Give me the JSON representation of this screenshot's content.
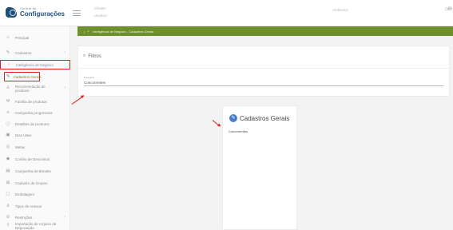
{
  "header": {
    "logo_small": "Central de",
    "logo_main": "Configurações",
    "client_label": "Cliente:",
    "user_label": "Usuário:",
    "environment_label": "Ambiente:",
    "top_icons": "⌂⊖"
  },
  "sidebar": {
    "items": [
      {
        "label": "Principal",
        "icon": "home-icon",
        "glyph": "⌂"
      },
      {
        "label": "Cadastros",
        "icon": "edit-icon",
        "glyph": "✎",
        "chevron": "›"
      },
      {
        "label": "Inteligência de Negócio",
        "icon": "bulb-icon",
        "glyph": "♀",
        "chevron": "›"
      },
      {
        "label": "Cadastros Gerais",
        "icon": "edit-icon",
        "glyph": "✎"
      },
      {
        "label": "Recomendação de produtos",
        "icon": "bag-icon",
        "glyph": "♙",
        "chevron": "›"
      },
      {
        "label": "Família de produtos",
        "icon": "family-icon",
        "glyph": "Ψ"
      },
      {
        "label": "Campanha progressiva",
        "icon": "steps-icon",
        "glyph": "≡"
      },
      {
        "label": "Detalhes de produtos",
        "icon": "info-icon",
        "glyph": "ⓘ"
      },
      {
        "label": "Dias Úteis",
        "icon": "calendar-icon",
        "glyph": "▣"
      },
      {
        "label": "Metas",
        "icon": "target-icon",
        "glyph": "◎"
      },
      {
        "label": "Combo de Descontos",
        "icon": "tags-icon",
        "glyph": "◆"
      },
      {
        "label": "Campanha de Brindes",
        "icon": "gift-icon",
        "glyph": "▤"
      },
      {
        "label": "Cadastro de Grupos",
        "icon": "group-icon",
        "glyph": "⊞"
      },
      {
        "label": "Embalagem",
        "icon": "package-icon",
        "glyph": "▢"
      },
      {
        "label": "Tipos de Anexos",
        "icon": "clip-icon",
        "glyph": "∂"
      },
      {
        "label": "Restrições",
        "icon": "restrict-icon",
        "glyph": "⊘",
        "chevron": "›"
      },
      {
        "label": "Importação de Arquivo de Negociação",
        "icon": "import-icon",
        "glyph": "⇪"
      }
    ]
  },
  "breadcrumb": {
    "separator": "|",
    "home_glyph": "⌂",
    "path": "Inteligência de Negócio - Cadastros Gerais"
  },
  "filters": {
    "title": "Filtros",
    "search_glyph": "⌕",
    "field_label": "Pesquisar",
    "field_value": "Concorrentes"
  },
  "card": {
    "badge_glyph": "✎",
    "title": "Cadastros Gerais",
    "item": "Concorrentes"
  }
}
